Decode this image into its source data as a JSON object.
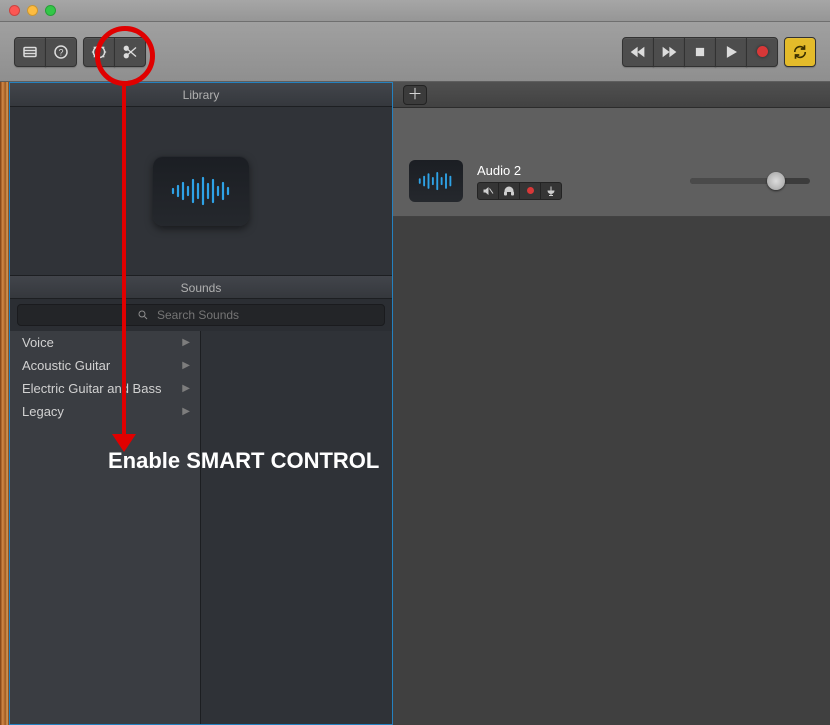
{
  "library": {
    "title": "Library",
    "sounds_title": "Sounds",
    "search_placeholder": "Search Sounds",
    "categories": [
      {
        "label": "Voice"
      },
      {
        "label": "Acoustic Guitar"
      },
      {
        "label": "Electric Guitar and Bass"
      },
      {
        "label": "Legacy"
      }
    ]
  },
  "track": {
    "name": "Audio 2"
  },
  "annotation": {
    "text": "Enable SMART CONTROL"
  }
}
